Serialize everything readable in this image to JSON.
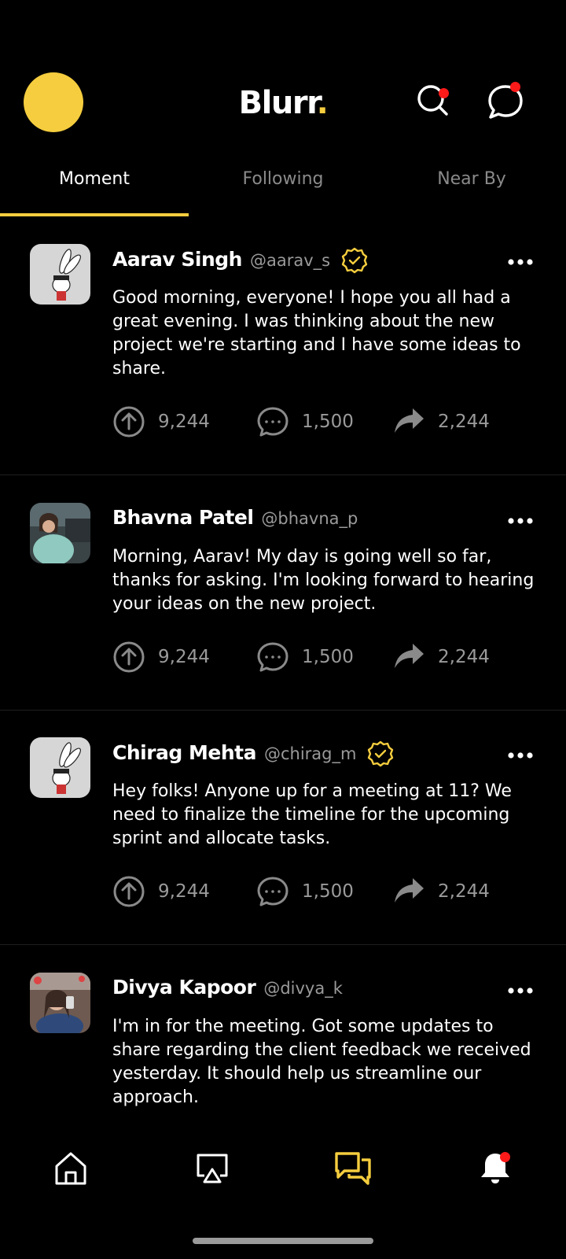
{
  "app": {
    "brand_name": "Blurr",
    "brand_dot": ".",
    "accent_color": "#f5cd3e",
    "notification_dot_color": "#ff1a1a"
  },
  "tabs": [
    {
      "label": "Moment",
      "active": true
    },
    {
      "label": "Following",
      "active": false
    },
    {
      "label": "Near By",
      "active": false
    }
  ],
  "posts": [
    {
      "name": "Aarav Singh",
      "handle": "@aarav_s",
      "verified": true,
      "avatar": "bunny-cartoon-avatar",
      "text": "Good morning, everyone! I hope you all had a great evening. I was thinking about the new project we're starting and I have some ideas to share.",
      "upvotes": "9,244",
      "comments": "1,500",
      "shares": "2,244"
    },
    {
      "name": "Bhavna Patel",
      "handle": "@bhavna_p",
      "verified": false,
      "avatar": "photo-woman-sofa",
      "text": "Morning, Aarav! My day is going well so far, thanks for asking. I'm looking forward to hearing your ideas on the new project.",
      "upvotes": "9,244",
      "comments": "1,500",
      "shares": "2,244"
    },
    {
      "name": "Chirag Mehta",
      "handle": "@chirag_m",
      "verified": true,
      "avatar": "bunny-cartoon-avatar",
      "text": "Hey folks! Anyone up for a meeting at 11? We need to finalize the timeline for the upcoming sprint and allocate tasks.",
      "upvotes": "9,244",
      "comments": "1,500",
      "shares": "2,244"
    },
    {
      "name": "Divya Kapoor",
      "handle": "@divya_k",
      "verified": false,
      "avatar": "photo-woman-selfie",
      "text": "I'm in for the meeting. Got some updates to share regarding the client feedback we received yesterday. It should help us streamline our approach."
    }
  ],
  "icons": {
    "header": [
      "search-icon",
      "chat-bubble-icon"
    ],
    "post_actions": [
      "upvote-icon",
      "comment-icon",
      "share-icon"
    ],
    "bottom_nav": [
      "home-icon",
      "screen-cast-icon",
      "messages-icon",
      "bell-icon"
    ]
  }
}
